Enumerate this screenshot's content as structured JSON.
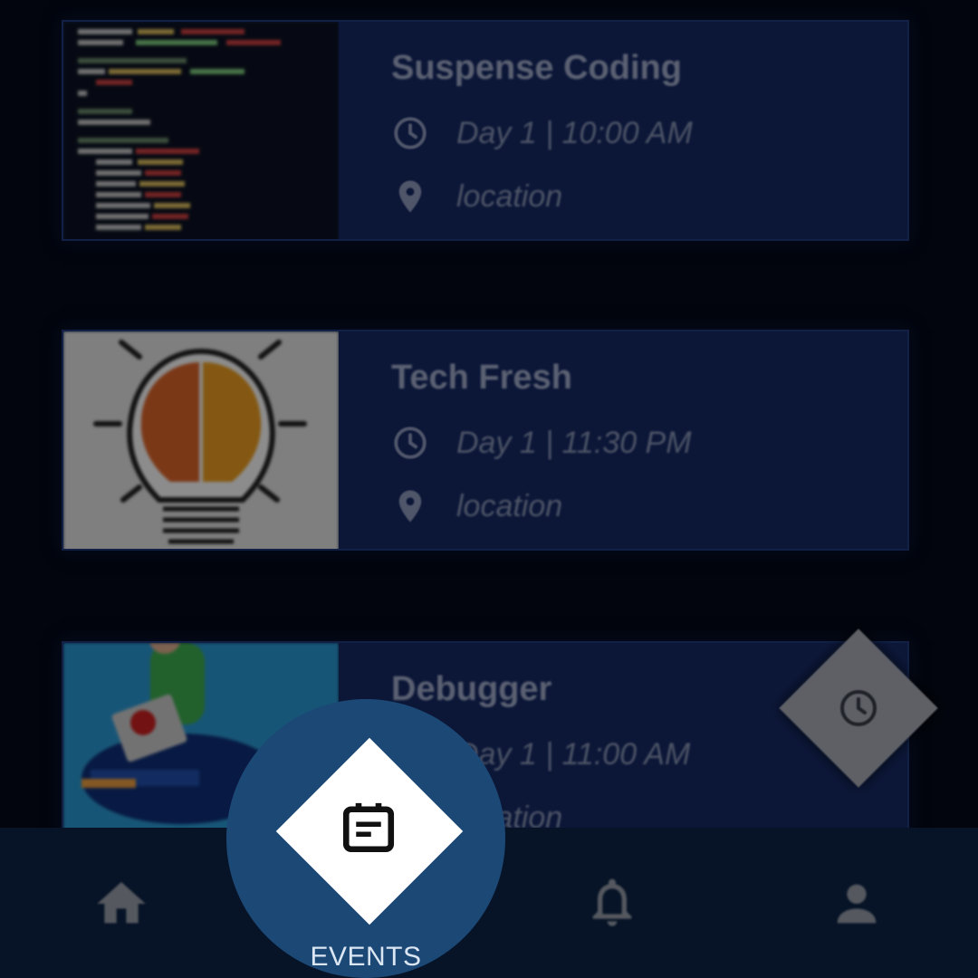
{
  "events": [
    {
      "title": "Suspense Coding",
      "time": "Day 1 | 10:00 AM",
      "location": "location",
      "thumb": "code"
    },
    {
      "title": "Tech Fresh",
      "time": "Day 1 | 11:30 PM",
      "location": "location",
      "thumb": "bulb"
    },
    {
      "title": "Debugger",
      "time": "Day 1 | 11:00 AM",
      "location": "location",
      "thumb": "debug"
    }
  ],
  "fab": {
    "icon": "clock-icon"
  },
  "navbar": {
    "items": [
      {
        "icon": "home-icon"
      },
      {
        "icon": "events-calendar-icon",
        "label": "EVENTS",
        "active": true
      },
      {
        "icon": "bell-icon"
      },
      {
        "icon": "person-icon"
      }
    ]
  },
  "colors": {
    "background": "#02050d",
    "card": "#0c1738",
    "active_nav": "#1c4876",
    "navbar": "#071427"
  }
}
